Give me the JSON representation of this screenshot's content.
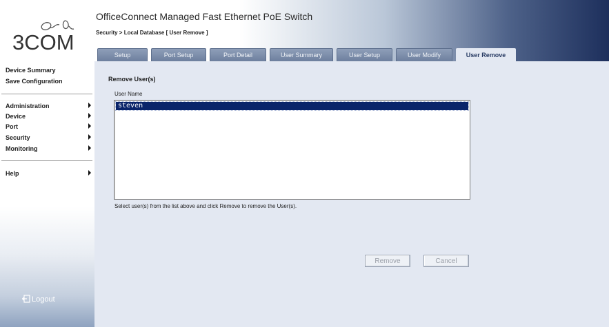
{
  "brand": {
    "logo_text": "3COM"
  },
  "header": {
    "app_title": "OfficeConnect Managed Fast Ethernet PoE Switch",
    "breadcrumb": "Security > Local Database [ User Remove ]"
  },
  "tabs": [
    {
      "label": "Setup",
      "active": false
    },
    {
      "label": "Port Setup",
      "active": false
    },
    {
      "label": "Port Detail",
      "active": false
    },
    {
      "label": "User Summary",
      "active": false
    },
    {
      "label": "User Setup",
      "active": false
    },
    {
      "label": "User Modify",
      "active": false
    },
    {
      "label": "User Remove",
      "active": true
    }
  ],
  "sidebar": {
    "top_links": [
      "Device Summary",
      "Save Configuration"
    ],
    "menus": [
      "Administration",
      "Device",
      "Port",
      "Security",
      "Monitoring"
    ],
    "help": "Help",
    "logout": "Logout"
  },
  "main": {
    "section_title": "Remove User(s)",
    "list_label": "User Name",
    "users": [
      {
        "name": "steven",
        "selected": true
      }
    ],
    "help_text": "Select user(s) from the list above and click Remove to remove the User(s).",
    "remove_label": "Remove",
    "cancel_label": "Cancel"
  },
  "colors": {
    "selection": "#0a246a",
    "panel": "#e3e8f2",
    "header_dark": "#1d2f5c"
  }
}
